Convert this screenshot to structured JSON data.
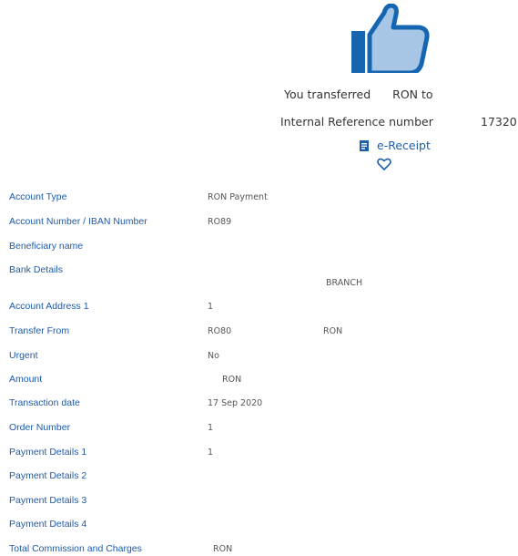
{
  "colors": {
    "accent": "#1d5ea8",
    "icon_dark": "#1565b0",
    "icon_light": "#a7c6e6",
    "label": "#1e5aa8",
    "text": "#333333",
    "value": "#555555"
  },
  "icons": {
    "success": "thumbs-up-icon",
    "receipt": "receipt-icon",
    "favorite": "heart-icon"
  },
  "summary": {
    "transfer_prefix": "You transferred",
    "transfer_amount": "RON to",
    "reference_label": "Internal Reference number",
    "reference_value": "17320",
    "receipt_label": "e-Receipt"
  },
  "details": {
    "account_type": {
      "label": "Account Type",
      "value": "RON Payment"
    },
    "account_number": {
      "label": "Account Number / IBAN Number",
      "value": "RO89"
    },
    "beneficiary_name": {
      "label": "Beneficiary name",
      "value": ""
    },
    "bank_details": {
      "label": "Bank Details",
      "value": "BRANCH"
    },
    "account_address_1": {
      "label": "Account Address 1",
      "value": "1"
    },
    "transfer_from": {
      "label": "Transfer From",
      "value": "RO80",
      "currency": "RON"
    },
    "urgent": {
      "label": "Urgent",
      "value": "No"
    },
    "amount": {
      "label": "Amount",
      "value": "RON"
    },
    "transaction_date": {
      "label": "Transaction date",
      "value": "17 Sep 2020"
    },
    "order_number": {
      "label": "Order Number",
      "value": "1"
    },
    "payment_details_1": {
      "label": "Payment Details 1",
      "value": "1"
    },
    "payment_details_2": {
      "label": "Payment Details 2",
      "value": ""
    },
    "payment_details_3": {
      "label": "Payment Details 3",
      "value": ""
    },
    "payment_details_4": {
      "label": "Payment Details 4",
      "value": ""
    },
    "total_commission": {
      "label": "Total Commission and Charges",
      "value": "RON"
    }
  }
}
